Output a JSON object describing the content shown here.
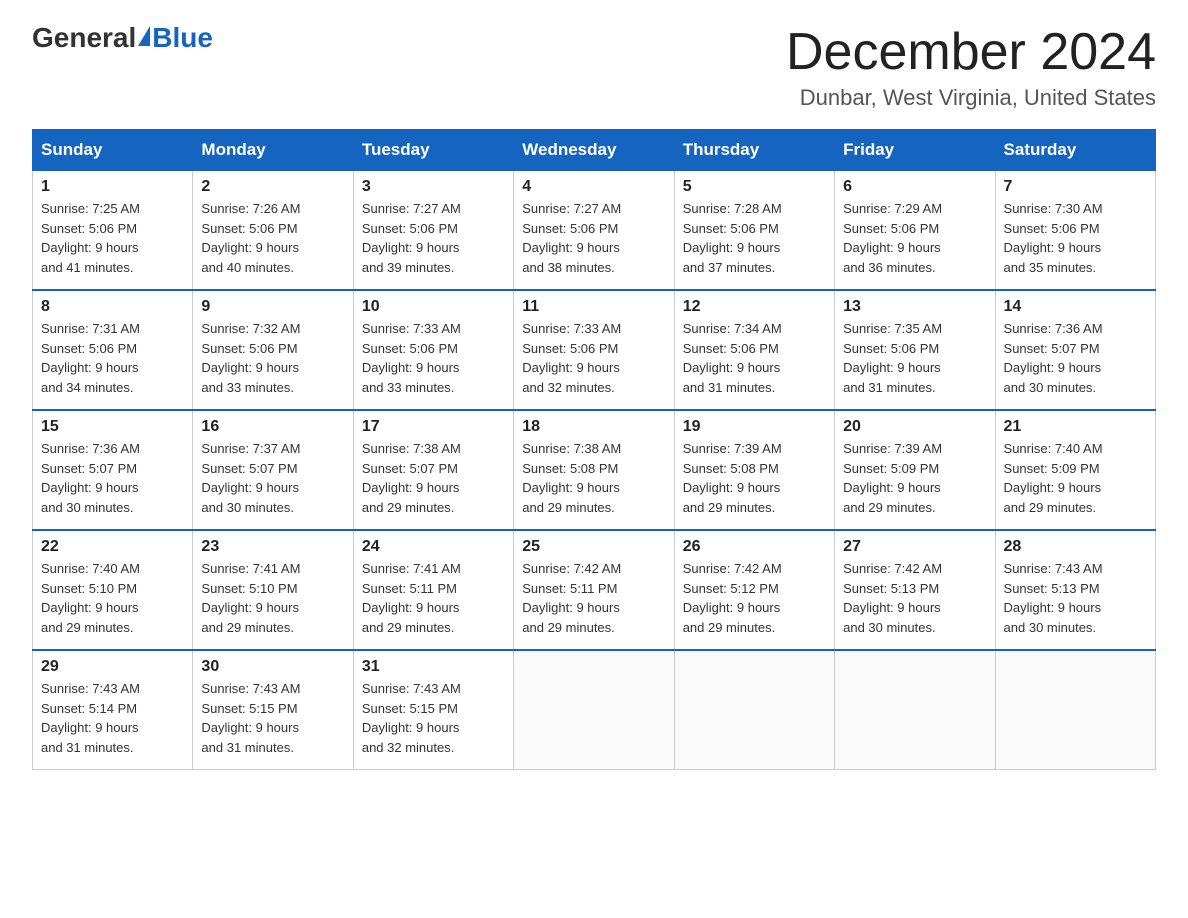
{
  "header": {
    "logo_general": "General",
    "logo_blue": "Blue",
    "month_title": "December 2024",
    "location": "Dunbar, West Virginia, United States"
  },
  "days_of_week": [
    "Sunday",
    "Monday",
    "Tuesday",
    "Wednesday",
    "Thursday",
    "Friday",
    "Saturday"
  ],
  "weeks": [
    [
      {
        "day": "1",
        "sunrise": "7:25 AM",
        "sunset": "5:06 PM",
        "daylight": "9 hours and 41 minutes."
      },
      {
        "day": "2",
        "sunrise": "7:26 AM",
        "sunset": "5:06 PM",
        "daylight": "9 hours and 40 minutes."
      },
      {
        "day": "3",
        "sunrise": "7:27 AM",
        "sunset": "5:06 PM",
        "daylight": "9 hours and 39 minutes."
      },
      {
        "day": "4",
        "sunrise": "7:27 AM",
        "sunset": "5:06 PM",
        "daylight": "9 hours and 38 minutes."
      },
      {
        "day": "5",
        "sunrise": "7:28 AM",
        "sunset": "5:06 PM",
        "daylight": "9 hours and 37 minutes."
      },
      {
        "day": "6",
        "sunrise": "7:29 AM",
        "sunset": "5:06 PM",
        "daylight": "9 hours and 36 minutes."
      },
      {
        "day": "7",
        "sunrise": "7:30 AM",
        "sunset": "5:06 PM",
        "daylight": "9 hours and 35 minutes."
      }
    ],
    [
      {
        "day": "8",
        "sunrise": "7:31 AM",
        "sunset": "5:06 PM",
        "daylight": "9 hours and 34 minutes."
      },
      {
        "day": "9",
        "sunrise": "7:32 AM",
        "sunset": "5:06 PM",
        "daylight": "9 hours and 33 minutes."
      },
      {
        "day": "10",
        "sunrise": "7:33 AM",
        "sunset": "5:06 PM",
        "daylight": "9 hours and 33 minutes."
      },
      {
        "day": "11",
        "sunrise": "7:33 AM",
        "sunset": "5:06 PM",
        "daylight": "9 hours and 32 minutes."
      },
      {
        "day": "12",
        "sunrise": "7:34 AM",
        "sunset": "5:06 PM",
        "daylight": "9 hours and 31 minutes."
      },
      {
        "day": "13",
        "sunrise": "7:35 AM",
        "sunset": "5:06 PM",
        "daylight": "9 hours and 31 minutes."
      },
      {
        "day": "14",
        "sunrise": "7:36 AM",
        "sunset": "5:07 PM",
        "daylight": "9 hours and 30 minutes."
      }
    ],
    [
      {
        "day": "15",
        "sunrise": "7:36 AM",
        "sunset": "5:07 PM",
        "daylight": "9 hours and 30 minutes."
      },
      {
        "day": "16",
        "sunrise": "7:37 AM",
        "sunset": "5:07 PM",
        "daylight": "9 hours and 30 minutes."
      },
      {
        "day": "17",
        "sunrise": "7:38 AM",
        "sunset": "5:07 PM",
        "daylight": "9 hours and 29 minutes."
      },
      {
        "day": "18",
        "sunrise": "7:38 AM",
        "sunset": "5:08 PM",
        "daylight": "9 hours and 29 minutes."
      },
      {
        "day": "19",
        "sunrise": "7:39 AM",
        "sunset": "5:08 PM",
        "daylight": "9 hours and 29 minutes."
      },
      {
        "day": "20",
        "sunrise": "7:39 AM",
        "sunset": "5:09 PM",
        "daylight": "9 hours and 29 minutes."
      },
      {
        "day": "21",
        "sunrise": "7:40 AM",
        "sunset": "5:09 PM",
        "daylight": "9 hours and 29 minutes."
      }
    ],
    [
      {
        "day": "22",
        "sunrise": "7:40 AM",
        "sunset": "5:10 PM",
        "daylight": "9 hours and 29 minutes."
      },
      {
        "day": "23",
        "sunrise": "7:41 AM",
        "sunset": "5:10 PM",
        "daylight": "9 hours and 29 minutes."
      },
      {
        "day": "24",
        "sunrise": "7:41 AM",
        "sunset": "5:11 PM",
        "daylight": "9 hours and 29 minutes."
      },
      {
        "day": "25",
        "sunrise": "7:42 AM",
        "sunset": "5:11 PM",
        "daylight": "9 hours and 29 minutes."
      },
      {
        "day": "26",
        "sunrise": "7:42 AM",
        "sunset": "5:12 PM",
        "daylight": "9 hours and 29 minutes."
      },
      {
        "day": "27",
        "sunrise": "7:42 AM",
        "sunset": "5:13 PM",
        "daylight": "9 hours and 30 minutes."
      },
      {
        "day": "28",
        "sunrise": "7:43 AM",
        "sunset": "5:13 PM",
        "daylight": "9 hours and 30 minutes."
      }
    ],
    [
      {
        "day": "29",
        "sunrise": "7:43 AM",
        "sunset": "5:14 PM",
        "daylight": "9 hours and 31 minutes."
      },
      {
        "day": "30",
        "sunrise": "7:43 AM",
        "sunset": "5:15 PM",
        "daylight": "9 hours and 31 minutes."
      },
      {
        "day": "31",
        "sunrise": "7:43 AM",
        "sunset": "5:15 PM",
        "daylight": "9 hours and 32 minutes."
      },
      null,
      null,
      null,
      null
    ]
  ],
  "labels": {
    "sunrise_prefix": "Sunrise: ",
    "sunset_prefix": "Sunset: ",
    "daylight_prefix": "Daylight: "
  }
}
